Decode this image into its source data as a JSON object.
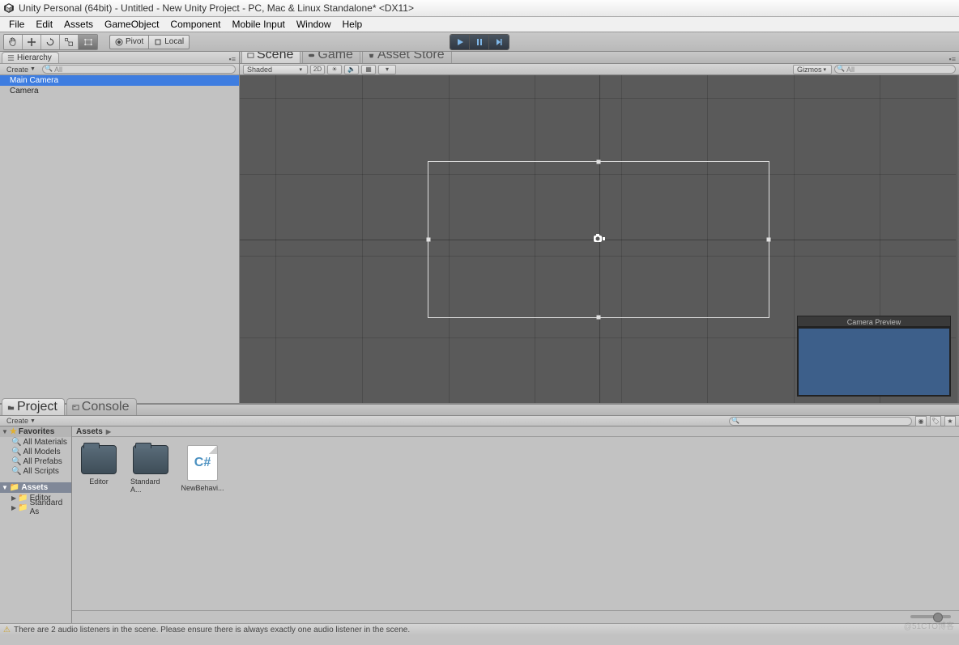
{
  "window": {
    "title": "Unity Personal (64bit) - Untitled - New Unity Project - PC, Mac & Linux Standalone* <DX11>"
  },
  "menu": [
    "File",
    "Edit",
    "Assets",
    "GameObject",
    "Component",
    "Mobile Input",
    "Window",
    "Help"
  ],
  "toolbar": {
    "pivot_label": "Pivot",
    "local_label": "Local"
  },
  "hierarchy": {
    "tab_label": "Hierarchy",
    "create_label": "Create",
    "search_placeholder": "All",
    "items": [
      {
        "label": "Main Camera",
        "selected": true
      },
      {
        "label": "Camera",
        "selected": false
      }
    ]
  },
  "center": {
    "tabs": [
      {
        "label": "Scene",
        "active": true,
        "icon": "scene"
      },
      {
        "label": "Game",
        "active": false,
        "icon": "game"
      },
      {
        "label": "Asset Store",
        "active": false,
        "icon": "store"
      }
    ],
    "shading_mode": "Shaded",
    "mode_2d": "2D",
    "gizmos_label": "Gizmos",
    "right_search_placeholder": "All",
    "camera_preview_label": "Camera Preview"
  },
  "project": {
    "tabs": [
      {
        "label": "Project",
        "active": true
      },
      {
        "label": "Console",
        "active": false
      }
    ],
    "create_label": "Create",
    "favorites_label": "Favorites",
    "favorites": [
      "All Materials",
      "All Models",
      "All Prefabs",
      "All Scripts"
    ],
    "assets_root_label": "Assets",
    "tree_folders": [
      "Editor",
      "Standard As"
    ],
    "breadcrumb": "Assets",
    "grid_items": [
      {
        "type": "folder",
        "label": "Editor"
      },
      {
        "type": "folder",
        "label": "Standard A..."
      },
      {
        "type": "script",
        "label": "NewBehavi..."
      }
    ]
  },
  "status": {
    "message": "There are 2 audio listeners in the scene. Please ensure there is always exactly one audio listener in the scene."
  },
  "watermark": "@51CTO博客"
}
